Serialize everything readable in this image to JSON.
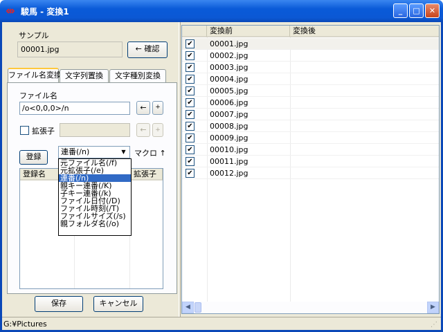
{
  "window": {
    "title": "駿馬 - 変換1",
    "app_icon": "horse-app-icon",
    "minimize": "_",
    "maximize": "□",
    "close": "✕"
  },
  "left": {
    "sample_label": "サンプル",
    "sample_value": "00001.jpg",
    "confirm_button": "← 確認",
    "tabs": [
      {
        "label": "ファイル名変換",
        "active": true
      },
      {
        "label": "文字列置換",
        "active": false
      },
      {
        "label": "文字種別変換",
        "active": false
      }
    ],
    "filename_label": "ファイル名",
    "filename_value": "/o<0,0,0>/n",
    "arrow_button": "←",
    "plus_button": "+",
    "ext_label": "拡張子",
    "ext_value": "",
    "register_button": "登録",
    "macro_select_value": "連番(/n)",
    "macro_label": "マクロ ↑",
    "list_col_name": "登録名",
    "list_col_ext": "拡張子",
    "macro_options": [
      {
        "label": "元ファイル名(/f)",
        "selected": false
      },
      {
        "label": "元拡張子(/e)",
        "selected": false
      },
      {
        "label": "連番(/n)",
        "selected": true
      },
      {
        "label": "親キー連番(/K)",
        "selected": false
      },
      {
        "label": "子キー連番(/k)",
        "selected": false
      },
      {
        "label": "ファイル日付(/D)",
        "selected": false
      },
      {
        "label": "ファイル時刻(/T)",
        "selected": false
      },
      {
        "label": "ファイルサイズ(/s)",
        "selected": false
      },
      {
        "label": "親フォルダ名(/o)",
        "selected": false
      }
    ],
    "save_button": "保存",
    "cancel_button": "キャンセル"
  },
  "right": {
    "col_before": "変換前",
    "col_after": "変換後",
    "rows": [
      {
        "checked": true,
        "before": "00001.jpg",
        "after": ""
      },
      {
        "checked": true,
        "before": "00002.jpg",
        "after": ""
      },
      {
        "checked": true,
        "before": "00003.jpg",
        "after": ""
      },
      {
        "checked": true,
        "before": "00004.jpg",
        "after": ""
      },
      {
        "checked": true,
        "before": "00005.jpg",
        "after": ""
      },
      {
        "checked": true,
        "before": "00006.jpg",
        "after": ""
      },
      {
        "checked": true,
        "before": "00007.jpg",
        "after": ""
      },
      {
        "checked": true,
        "before": "00008.jpg",
        "after": ""
      },
      {
        "checked": true,
        "before": "00009.jpg",
        "after": ""
      },
      {
        "checked": true,
        "before": "00010.jpg",
        "after": ""
      },
      {
        "checked": true,
        "before": "00011.jpg",
        "after": ""
      },
      {
        "checked": true,
        "before": "00012.jpg",
        "after": ""
      }
    ]
  },
  "status": {
    "path": "G:¥Pictures"
  },
  "colors": {
    "title_bar": "#0a5ad8",
    "selection": "#316ac5",
    "tab_highlight": "#ffc83c"
  }
}
